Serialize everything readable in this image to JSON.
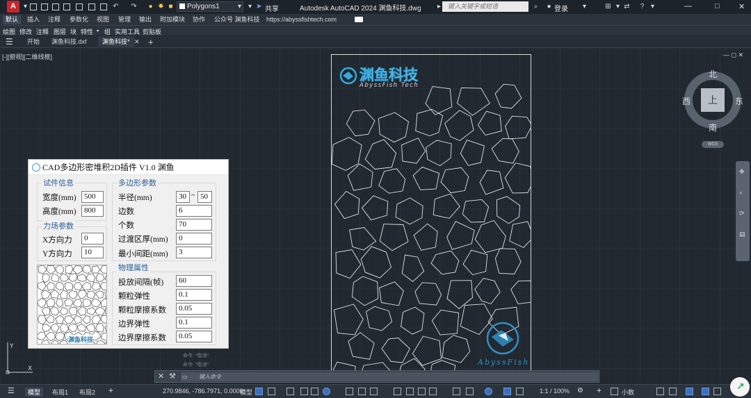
{
  "titlebar": {
    "app_button": "A",
    "layer_combo": "Polygons1",
    "share_label": "共享",
    "app_title": "Autodesk AutoCAD 2024    渊鱼科技.dwg",
    "search_placeholder": "键入关键字或短语",
    "login_label": "登录"
  },
  "ribbon_tabs": [
    "默认",
    "插入",
    "注释",
    "参数化",
    "视图",
    "管理",
    "输出",
    "附加模块",
    "协作",
    "公众号 渊鱼科技",
    "https://abyssfishtech.com"
  ],
  "menu_items": [
    "绘图",
    "修改",
    "注释",
    "图层",
    "块",
    "特性",
    "组",
    "实用工具",
    "剪贴板"
  ],
  "doc_tabs": {
    "start": "开始",
    "file1": "渊鱼科技.dxf",
    "file2": "渊鱼科技*"
  },
  "viewport": {
    "view_label": "[-][俯视][二维线框]",
    "cube": {
      "north": "北",
      "south": "南",
      "east": "东",
      "west": "西",
      "top": "上",
      "wcs": "WCS"
    },
    "drawing_title": "渊鱼科技",
    "drawing_subtitle": "AbyssFish Tech",
    "drawing_watermark": "AbyssFish"
  },
  "plugin": {
    "title": "CAD多边形密堆积2D插件 V1.0 渊鱼",
    "specimen": {
      "title": "试件信息",
      "width_label": "宽度(mm)",
      "width_value": "500",
      "height_label": "高度(mm)",
      "height_value": "800"
    },
    "force": {
      "title": "力场参数",
      "x_label": "X方向力",
      "x_value": "0",
      "y_label": "Y方向力",
      "y_value": "10"
    },
    "polygon": {
      "title": "多边形参数",
      "radius_label": "半径(mm)",
      "radius_min": "30",
      "radius_sep": "~",
      "radius_max": "50",
      "sides_label": "边数",
      "sides_value": "6",
      "count_label": "个数",
      "count_value": "70",
      "transition_label": "过渡区厚(mm)",
      "transition_value": "0",
      "gap_label": "最小间距(mm)",
      "gap_value": "3"
    },
    "physics": {
      "title": "物理属性",
      "interval_label": "投放间隔(帧)",
      "interval_value": "60",
      "elasticity_label": "颗粒弹性",
      "elasticity_value": "0.1",
      "friction_label": "颗粒摩擦系数",
      "friction_value": "0.05",
      "boundary_elasticity_label": "边界弹性",
      "boundary_elasticity_value": "0.1",
      "boundary_friction_label": "边界摩擦系数",
      "boundary_friction_value": "0.05"
    },
    "preview_caption": "渊鱼科技"
  },
  "command": {
    "history": [
      "命令: *取消*",
      "命令: *取消*"
    ],
    "placeholder": "键入命令"
  },
  "ucs": {
    "y": "Y",
    "x": "X"
  },
  "statusbar": {
    "layout_tabs": [
      "模型",
      "布局1",
      "布局2"
    ],
    "coordinates": "270.9846, -786.7971, 0.0000",
    "model_label": "模型",
    "scale": "1:1 / 100%",
    "units": "小数"
  }
}
